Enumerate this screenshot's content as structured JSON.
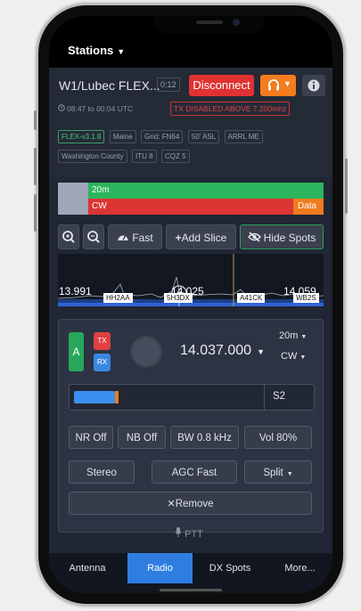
{
  "topbar": {
    "stations_label": "Stations"
  },
  "radio": {
    "title": "W1/Lubec FLEX...",
    "timer": "0:12",
    "disconnect_label": "Disconnect",
    "times": "08:47 to 00:04 UTC",
    "tx_warning": "TX DISABLED ABOVE 7.200mhz",
    "tags": [
      "FLEX-v3.1.8",
      "Maine",
      "Grid: FN64",
      "50' ASL",
      "ARRL ME",
      "Washington County",
      "ITU 8",
      "CQZ 5"
    ]
  },
  "bands": {
    "band": "20m",
    "mode": "CW",
    "data": "Data"
  },
  "toolbar": {
    "fast_label": "Fast",
    "add_slice_label": "Add Slice",
    "hide_spots_label": "Hide Spots"
  },
  "panadapter": {
    "freq_left": "13.991",
    "freq_mid": "14.025",
    "freq_right": "14.059",
    "spots": [
      "HH2AA",
      "5H3DX",
      "A41CK",
      "WB2S"
    ]
  },
  "slice": {
    "letter": "A",
    "tx": "TX",
    "rx": "RX",
    "frequency": "14.037.000",
    "band": "20m",
    "mode": "CW",
    "s_meter": "S2",
    "s_meter_fill": 0.22,
    "buttons": {
      "nr": "NR Off",
      "nb": "NB Off",
      "bw": "BW 0.8 kHz",
      "vol": "Vol 80%",
      "stereo": "Stereo",
      "agc": "AGC Fast",
      "split": "Split",
      "remove": "Remove"
    }
  },
  "ptt_label": "PTT",
  "nav": {
    "items": [
      "Antenna",
      "Radio",
      "DX Spots",
      "More..."
    ],
    "active": "Radio"
  }
}
